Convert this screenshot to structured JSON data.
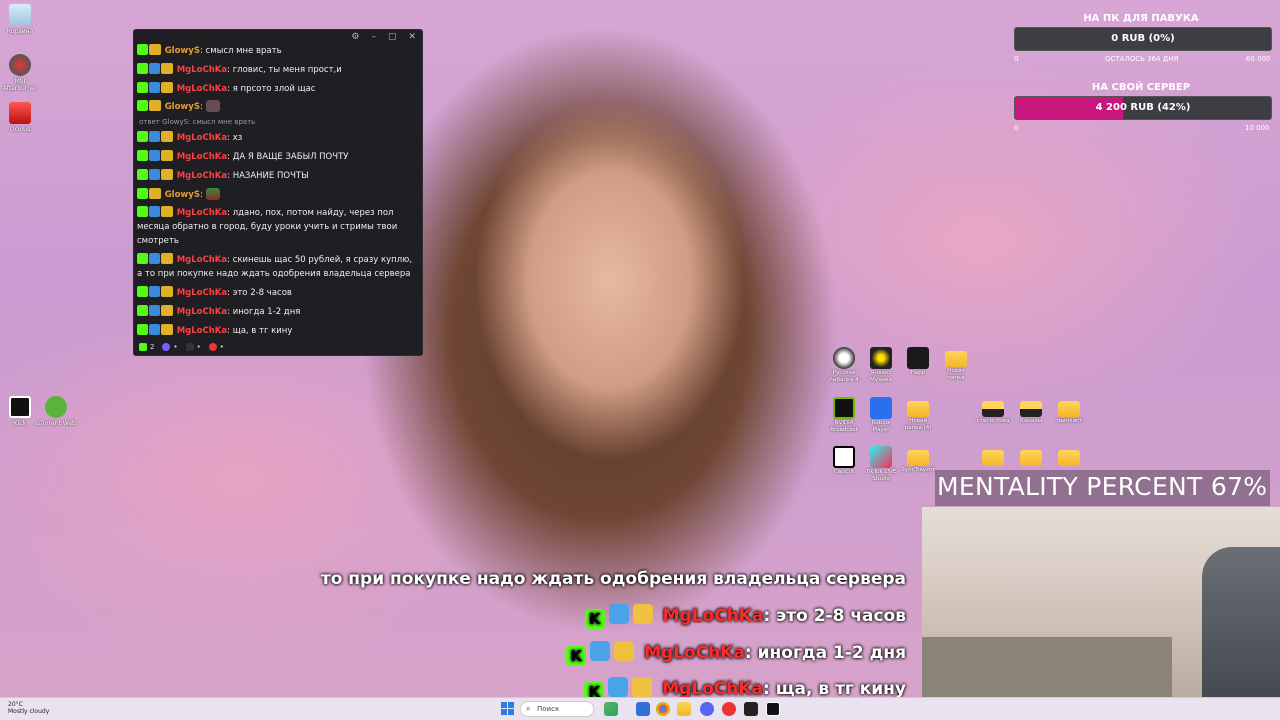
{
  "desktop_left": {
    "icons": [
      {
        "label": "Корзина",
        "icon": "recycle-bin-icon"
      },
      {
        "label": "MSI Afterburner",
        "icon": "afterburner-icon"
      },
      {
        "label": "Kick",
        "icon": "kick-icon"
      },
      {
        "label": "Oculus",
        "icon": "app-icon"
      },
      {
        "label": "uTorrent Web",
        "icon": "utorrent-icon"
      }
    ]
  },
  "chat_window": {
    "controls": [
      "⚙",
      "–",
      "▢",
      "✕"
    ],
    "messages": [
      {
        "nick": "GlowyS",
        "nick_color": "#e0a030",
        "text": ": смысл мне врать"
      },
      {
        "nick": "MgLoChKa",
        "nick_color": "#ff4040",
        "text": ": гловис, ты меня прост,и"
      },
      {
        "nick": "MgLoChKa",
        "nick_color": "#ff4040",
        "text": ": я прсото злой щас"
      },
      {
        "nick": "GlowyS",
        "nick_color": "#e0a030",
        "text": ":"
      },
      {
        "reply": "ответ GlowyS: смысл мне врать"
      },
      {
        "nick": "MgLoChKa",
        "nick_color": "#ff4040",
        "text": ": хз"
      },
      {
        "nick": "MgLoChKa",
        "nick_color": "#ff4040",
        "text": ": ДА Я ВАЩЕ ЗАБЫЛ ПОЧТУ"
      },
      {
        "nick": "MgLoChKa",
        "nick_color": "#ff4040",
        "text": ": НАЗАНИЕ ПОЧТЫ"
      },
      {
        "nick": "GlowyS",
        "nick_color": "#e0a030",
        "text": ":"
      },
      {
        "nick": "MgLoChKa",
        "nick_color": "#ff4040",
        "text": ": лдано, пох, потом найду, через пол месяца обратно в город, буду уроки учить и стримы твои смотреть"
      },
      {
        "nick": "MgLoChKa",
        "nick_color": "#ff4040",
        "text": ": скинешь щас 50 рублей, я сразу куплю, а то при покупке надо ждать одобрения владельца сервера"
      },
      {
        "nick": "MgLoChKa",
        "nick_color": "#ff4040",
        "text": ": это 2-8 часов"
      },
      {
        "nick": "MgLoChKa",
        "nick_color": "#ff4040",
        "text": ": иногда 1-2 дня"
      },
      {
        "nick": "MgLoChKa",
        "nick_color": "#ff4040",
        "text": ": ща, в тг кину"
      }
    ],
    "viewer_count": "2",
    "footer_dots": [
      "•",
      "•",
      "•"
    ]
  },
  "goals": [
    {
      "title": "НА ПК ДЛЯ ПАВУКА",
      "value_text": "0 RUB (0%)",
      "fraction": 0.0,
      "min": "0",
      "max": "60 000",
      "subtitle": "ОСТАЛОСЬ 364 ДНЯ",
      "fill_color": "#c8177c"
    },
    {
      "title": "НА СВОЙ СЕРВЕР",
      "value_text": "4 200 RUB (42%)",
      "fraction": 0.42,
      "min": "0",
      "max": "10 000",
      "fill_color": "#c8177c"
    }
  ],
  "mentality": {
    "text": "MENTALITY PERCENT 67%"
  },
  "overlay_chat": {
    "partial_line": "то при покупке надо ждать одобрения владельца сервера",
    "lines": [
      {
        "nick": "MgLoChKa",
        "text": ": это 2-8 часов"
      },
      {
        "nick": "MgLoChKa",
        "text": ": иногда 1-2 дня"
      },
      {
        "nick": "MgLoChKa",
        "text": ": ща, в тг кину"
      }
    ]
  },
  "desktop_right": {
    "icons": [
      {
        "label": "Русская Рыбалка 4",
        "icon": "fishing-icon"
      },
      {
        "label": "Яндекс Музыка",
        "icon": "yandex-music-icon"
      },
      {
        "label": "Happ",
        "icon": "happ-icon"
      },
      {
        "label": "Новая папка",
        "icon": "folder-icon"
      },
      {
        "label": "NVIDIA Broadcast",
        "icon": "nvidia-icon"
      },
      {
        "label": "Roblox Player",
        "icon": "roblox-icon"
      },
      {
        "label": "Новая папка (4)",
        "icon": "folder-icon"
      },
      {
        "label": "статистика",
        "icon": "folder-icon"
      },
      {
        "label": "Каналы",
        "icon": "folder-icon"
      },
      {
        "label": "твичлист",
        "icon": "folder-icon"
      },
      {
        "label": "CapCut",
        "icon": "capcut-icon"
      },
      {
        "label": "TikTok LIVE Studio",
        "icon": "tiktok-icon"
      },
      {
        "label": "SyncTrayzor",
        "icon": "folder-icon"
      }
    ]
  },
  "taskbar": {
    "weather_temp": "20°C",
    "weather_desc": "Mostly cloudy",
    "search_placeholder": "Поиск"
  }
}
